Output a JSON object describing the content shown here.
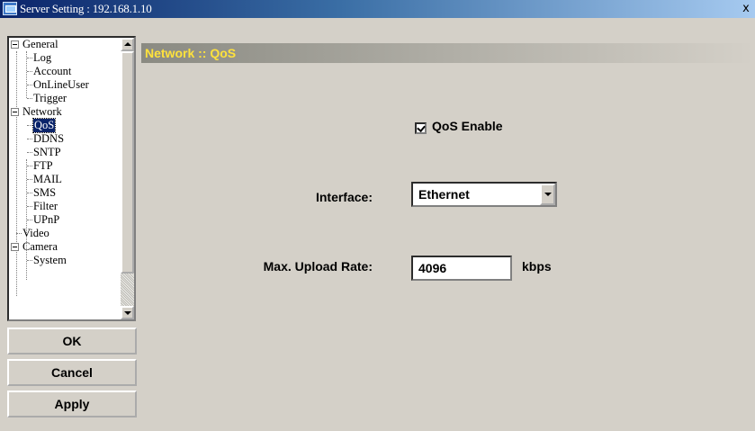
{
  "window": {
    "title": "Server Setting : 192.168.1.10",
    "close_label": "x"
  },
  "tree": {
    "general": "General",
    "log": "Log",
    "account": "Account",
    "online_user": "OnLineUser",
    "trigger": "Trigger",
    "network": "Network",
    "qos": "QoS",
    "ddns": "DDNS",
    "sntp": "SNTP",
    "ftp": "FTP",
    "mail": "MAIL",
    "sms": "SMS",
    "filter": "Filter",
    "upnp": "UPnP",
    "video": "Video",
    "camera": "Camera",
    "system": "System"
  },
  "buttons": {
    "ok": "OK",
    "cancel": "Cancel",
    "apply": "Apply"
  },
  "content": {
    "header": "Network :: QoS",
    "qos_enable_label": "QoS Enable",
    "qos_enabled": true,
    "interface_label": "Interface:",
    "interface_value": "Ethernet",
    "max_upload_label": "Max. Upload Rate:",
    "max_upload_value": "4096",
    "max_upload_unit": "kbps"
  },
  "colors": {
    "header_text": "#ffe23c",
    "selected_bg": "#0a246a"
  }
}
